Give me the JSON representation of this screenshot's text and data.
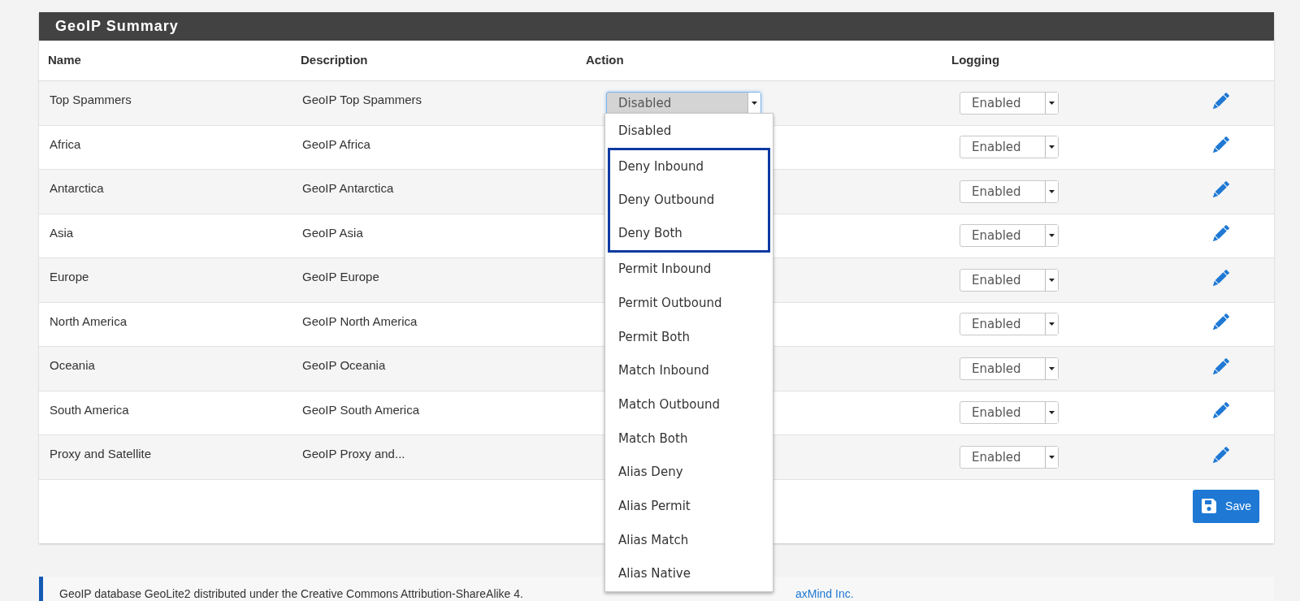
{
  "panel": {
    "title": "GeoIP Summary"
  },
  "table": {
    "columns": [
      "Name",
      "Description",
      "Action",
      "Logging"
    ],
    "rows": [
      {
        "name": "Top Spammers",
        "description": "GeoIP Top Spammers",
        "action": "Disabled",
        "logging": "Enabled"
      },
      {
        "name": "Africa",
        "description": "GeoIP Africa",
        "logging": "Enabled"
      },
      {
        "name": "Antarctica",
        "description": "GeoIP Antarctica",
        "logging": "Enabled"
      },
      {
        "name": "Asia",
        "description": "GeoIP Asia",
        "logging": "Enabled"
      },
      {
        "name": "Europe",
        "description": "GeoIP Europe",
        "logging": "Enabled"
      },
      {
        "name": "North America",
        "description": "GeoIP North America",
        "logging": "Enabled"
      },
      {
        "name": "Oceania",
        "description": "GeoIP Oceania",
        "logging": "Enabled"
      },
      {
        "name": "South America",
        "description": "GeoIP South America",
        "logging": "Enabled"
      },
      {
        "name": "Proxy and Satellite",
        "description": "GeoIP Proxy and...",
        "logging": "Enabled"
      }
    ]
  },
  "action_dropdown": {
    "options": [
      {
        "label": "Disabled",
        "outlined": false
      },
      {
        "label": "Deny Inbound",
        "outlined": true
      },
      {
        "label": "Deny Outbound",
        "outlined": true
      },
      {
        "label": "Deny Both",
        "outlined": true
      },
      {
        "label": "Permit Inbound",
        "outlined": false
      },
      {
        "label": "Permit Outbound",
        "outlined": false
      },
      {
        "label": "Permit Both",
        "outlined": false
      },
      {
        "label": "Match Inbound",
        "outlined": false
      },
      {
        "label": "Match Outbound",
        "outlined": false
      },
      {
        "label": "Match Both",
        "outlined": false
      },
      {
        "label": "Alias Deny",
        "outlined": false
      },
      {
        "label": "Alias Permit",
        "outlined": false
      },
      {
        "label": "Alias Match",
        "outlined": false
      },
      {
        "label": "Alias Native",
        "outlined": false
      }
    ]
  },
  "save_button": {
    "label": "Save"
  },
  "footer": {
    "text": "GeoIP database GeoLite2 distributed under the Creative Commons Attribution-ShareAlike 4.",
    "link": "axMind Inc."
  }
}
